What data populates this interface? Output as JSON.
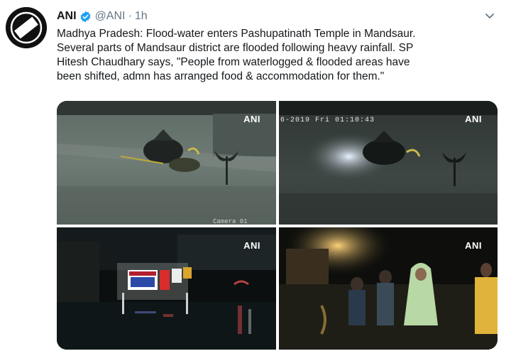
{
  "tweet": {
    "author_name": "ANI",
    "handle": "@ANI",
    "separator": "·",
    "time": "1h",
    "lines": [
      "Madhya Pradesh: Flood-water enters Pashupatinath Temple in Mandsaur.",
      "Several parts of Mandsaur district are flooded following heavy rainfall. SP",
      "Hitesh Chaudhary says, \"People from waterlogged & flooded areas have",
      "been shifted, admn has arranged food & accommodation for them.\""
    ]
  },
  "media": {
    "watermark": "ANI",
    "cctv_timestamp": "6-2019 Fri 01:10:43",
    "camera_label": "Camera 01"
  },
  "colors": {
    "verified": "#1da1f2",
    "text": "#14171a",
    "muted": "#657786"
  },
  "icons": {
    "avatar": "ani-logo",
    "verified": "verified-badge-icon",
    "caret": "chevron-down-icon"
  }
}
